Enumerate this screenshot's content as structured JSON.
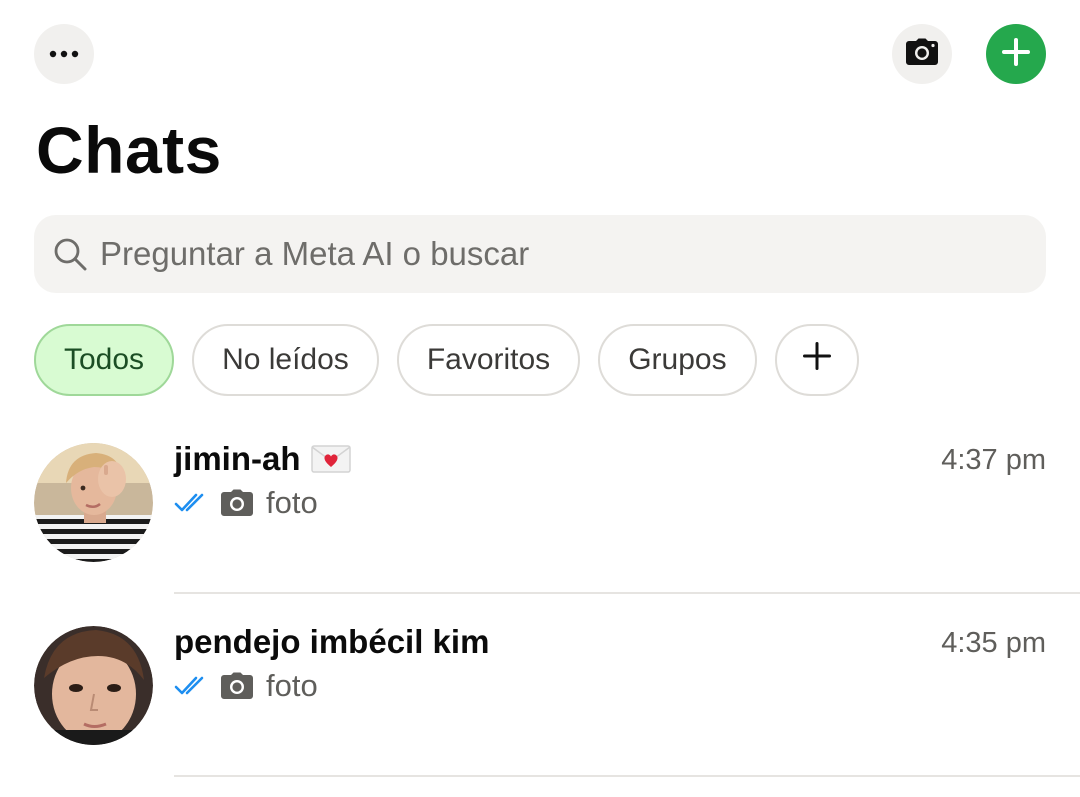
{
  "header": {
    "title": "Chats",
    "icons": {
      "more": "more-dots-icon",
      "camera": "camera-icon",
      "new_chat": "plus-icon"
    },
    "accent_color": "#25a84d"
  },
  "search": {
    "placeholder": "Preguntar a Meta AI o buscar",
    "icon": "search-icon"
  },
  "filters": [
    {
      "label": "Todos",
      "active": true
    },
    {
      "label": "No leídos",
      "active": false
    },
    {
      "label": "Favoritos",
      "active": false
    },
    {
      "label": "Grupos",
      "active": false
    }
  ],
  "chats": [
    {
      "name": "jimin-ah",
      "time": "4:37 pm",
      "status_icon": "double-check-icon",
      "media_icon": "camera-icon",
      "preview": "foto",
      "name_emoji": "love-letter-icon"
    },
    {
      "name": "pendejo imbécil kim",
      "time": "4:35 pm",
      "status_icon": "double-check-icon",
      "media_icon": "camera-icon",
      "preview": "foto"
    }
  ],
  "colors": {
    "read_check": "#1d8ef0",
    "chip_active_bg": "#d8fbd2"
  }
}
